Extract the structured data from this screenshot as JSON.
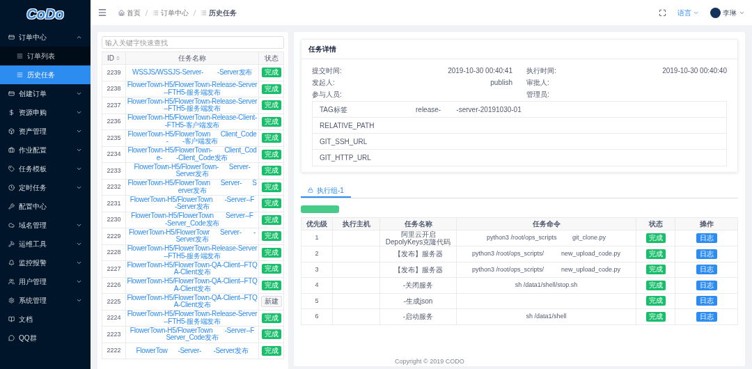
{
  "logo": "CoDo",
  "sidebar": {
    "items": [
      {
        "label": "订单中心",
        "expanded": true,
        "children": [
          {
            "label": "订单列表",
            "selected": false
          },
          {
            "label": "历史任务",
            "selected": true
          }
        ]
      },
      {
        "label": "创建订单",
        "expanded": false
      },
      {
        "label": "资源申购",
        "expanded": false
      },
      {
        "label": "资产管理",
        "expanded": false
      },
      {
        "label": "作业配置",
        "expanded": false
      },
      {
        "label": "任务模板",
        "expanded": false
      },
      {
        "label": "定时任务",
        "expanded": false
      },
      {
        "label": "配置中心"
      },
      {
        "label": "域名管理",
        "expanded": false
      },
      {
        "label": "运维工具",
        "expanded": false
      },
      {
        "label": "监控报警",
        "expanded": false
      },
      {
        "label": "用户管理",
        "expanded": false
      },
      {
        "label": "系统管理",
        "expanded": false
      },
      {
        "label": "文档"
      },
      {
        "label": "QQ群"
      }
    ]
  },
  "breadcrumb": [
    "首页",
    "订单中心",
    "历史任务"
  ],
  "header": {
    "language": "语言",
    "user": "李琳"
  },
  "task_list": {
    "search": {
      "placeholder": "输入关键字快速查找"
    },
    "columns": [
      "ID",
      "任务名称",
      "状态"
    ],
    "rows": [
      {
        "id": "2239",
        "name": "WSSJS/WSSJS-Server-        -Server发布",
        "status": "完成",
        "done": true
      },
      {
        "id": "2238",
        "name": "FlowerTown-H5/FlowerTown-Release-Server--FTH5-服务端发布",
        "status": "完成",
        "done": true
      },
      {
        "id": "2237",
        "name": "FlowerTown-H5/FlowerTown-Release-Server--FTH5-服务端发布",
        "status": "完成",
        "done": true
      },
      {
        "id": "2236",
        "name": "FlowerTown-H5/FlowerTown-Release-Client--FTH5-客户端发布",
        "status": "完成",
        "done": true
      },
      {
        "id": "2235",
        "name": "FlowerTown-H5/FlowerTown      Client_Code-        -客户端发布",
        "status": "完成",
        "done": true
      },
      {
        "id": "2234",
        "name": "FlowerTown-H5/FlowerTown-       Client_Code-        -Client_Code发布",
        "status": "完成",
        "done": true
      },
      {
        "id": "2233",
        "name": "FlowerTown-H5/FlowerTown-      Server-      Server发布",
        "status": "完成",
        "done": true
      },
      {
        "id": "2232",
        "name": "FlowerTown-H5/FlowerTown      Server-      Server发布",
        "status": "完成",
        "done": true
      },
      {
        "id": "2231",
        "name": "FlowerTown-H5/FlowerTown       -Server--F       -Server发布",
        "status": "完成",
        "done": true
      },
      {
        "id": "2230",
        "name": "FlowerTown-H5/FlowerTown       Server--F       -Server_Code发布",
        "status": "完成",
        "done": true
      },
      {
        "id": "2229",
        "name": "FlowerTown-H5/FlowerTowr      Server-       -Server发布",
        "status": "完成",
        "done": true
      },
      {
        "id": "2228",
        "name": "FlowerTown-H5/FlowerTown-Release-Server--FTH5-服务端发布",
        "status": "完成",
        "done": true
      },
      {
        "id": "2227",
        "name": "FlowerTown-H5/FlowerTown-QA-Client--FTQA-Client发布",
        "status": "完成",
        "done": true
      },
      {
        "id": "2226",
        "name": "FlowerTown-H5/FlowerTown-QA-Client--FTQA-Client发布",
        "status": "完成",
        "done": true
      },
      {
        "id": "2225",
        "name": "FlowerTown-H5/FlowerTown-QA-Client--FTQA-Client发布",
        "status": "新建",
        "done": false
      },
      {
        "id": "2224",
        "name": "FlowerTown-H5/FlowerTown-Release-Server--FTH5-服务端发布",
        "status": "完成",
        "done": true
      },
      {
        "id": "2223",
        "name": "FlowerTown-H5/FlowerTown       -Server--F       Server_Code发布",
        "status": "完成",
        "done": true
      },
      {
        "id": "2222",
        "name": "FlowerTow      -Server-       -Server发布",
        "status": "完成",
        "done": true
      }
    ]
  },
  "detail": {
    "title": "任务详情",
    "fields": [
      {
        "label": "提交时间:",
        "value": "2019-10-30 00:40:41"
      },
      {
        "label": "执行时间:",
        "value": "2019-10-30 00:40:40"
      },
      {
        "label": "发起人:",
        "value": "publish"
      },
      {
        "label": "审批人:"
      },
      {
        "label": "参与人员:"
      },
      {
        "label": "管理员:"
      }
    ],
    "params": [
      {
        "key": "TAG标签",
        "value": "release-        -server-20191030-01"
      },
      {
        "key": "RELATIVE_PATH"
      },
      {
        "key": "GIT_SSH_URL"
      },
      {
        "key": "GIT_HTTP_URL"
      }
    ]
  },
  "groups": {
    "tabs": [
      {
        "label": "执行组-1",
        "selected": true
      }
    ],
    "columns": [
      "优先级",
      "执行主机",
      "任务名称",
      "任务命令",
      "状态",
      "操作"
    ],
    "rows": [
      {
        "priority": "1",
        "name": "阿里云开启DepolyKeys克隆代码",
        "command": "python3 /root/ops_scripts         git_clone.py",
        "status": "完成",
        "action": "日志"
      },
      {
        "priority": "2",
        "name": "【发布】服务器",
        "command": "python3 /root/ops_scripts/          new_upload_code.py",
        "status": "完成",
        "action": "日志"
      },
      {
        "priority": "3",
        "name": "【发布】服务器",
        "command": "python3 /root/ops_scripts/          new_upload_code.py",
        "status": "完成",
        "action": "日志"
      },
      {
        "priority": "4",
        "name": "-关闭服务",
        "command": "sh /data1/shell/stop.sh",
        "status": "完成",
        "action": "日志"
      },
      {
        "priority": "5",
        "name": "-生成json",
        "status": "完成",
        "action": "日志"
      },
      {
        "priority": "6",
        "name": "-启动服务",
        "command": "sh /data1/shell",
        "status": "完成",
        "action": "日志"
      }
    ]
  },
  "footer": "Copyright © 2019 CODO"
}
